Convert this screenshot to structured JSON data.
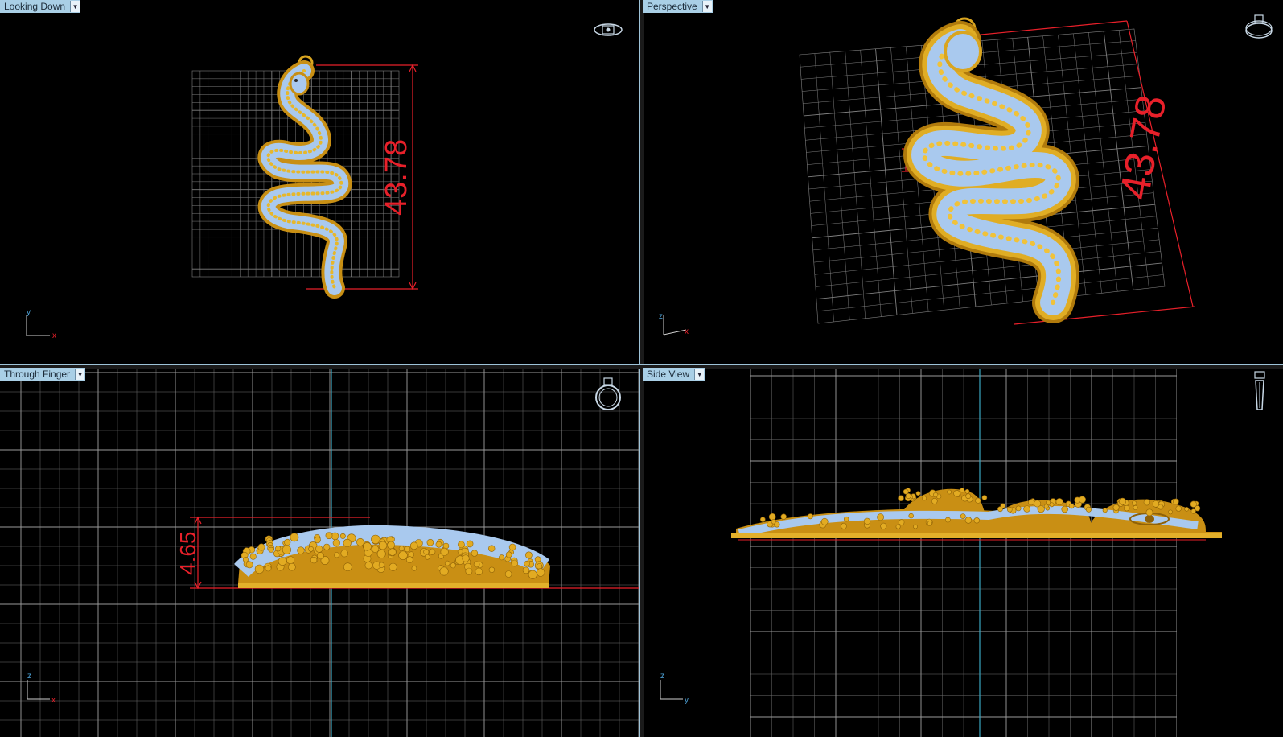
{
  "viewports": {
    "top_left": {
      "label": "Looking Down",
      "dimension": "43.78",
      "axis_v": "y",
      "axis_h": "x",
      "icon": "ring-top-view-icon"
    },
    "top_right": {
      "label": "Perspective",
      "dimension": "43.78",
      "axis_v": "z",
      "axis_h": "x",
      "icon": "ring-perspective-icon"
    },
    "bottom_left": {
      "label": "Through Finger",
      "dimension": "4.65",
      "axis_v": "z",
      "axis_h": "x",
      "icon": "ring-front-view-icon"
    },
    "bottom_right": {
      "label": "Side View",
      "axis_v": "z",
      "axis_h": "y",
      "icon": "ring-side-view-icon"
    }
  },
  "colors": {
    "background": "#000000",
    "grid": "#8a8a8a",
    "dimension": "#e8202a",
    "gold": "#d9a520",
    "gem": "#a9c9ee",
    "label_bg": "#a9cfe6",
    "axis_cyan": "#3aa6c0"
  }
}
